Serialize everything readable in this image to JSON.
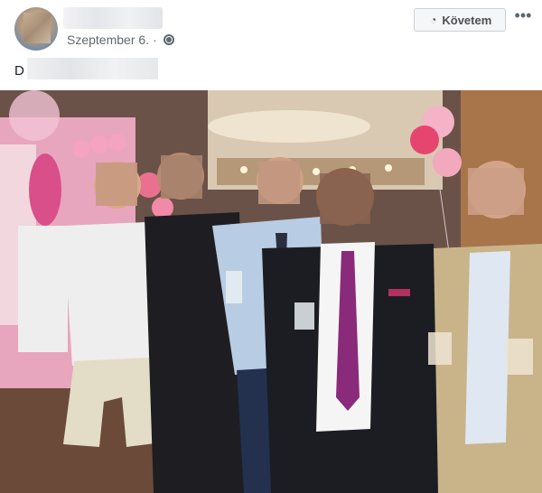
{
  "post": {
    "date": "Szeptember 6.",
    "separator": "·",
    "audience_icon": "globe-icon",
    "caption_prefix": "D"
  },
  "header": {
    "follow_label": "Követem",
    "follow_icon": "rss-icon",
    "more_label": "•••"
  },
  "photo": {
    "alt_icon": "group-photo"
  },
  "colors": {
    "button_bg": "#f5f6f7",
    "button_border": "#ccd0d5",
    "meta_text": "#616770",
    "tie_purple": "#8a2a7a"
  }
}
